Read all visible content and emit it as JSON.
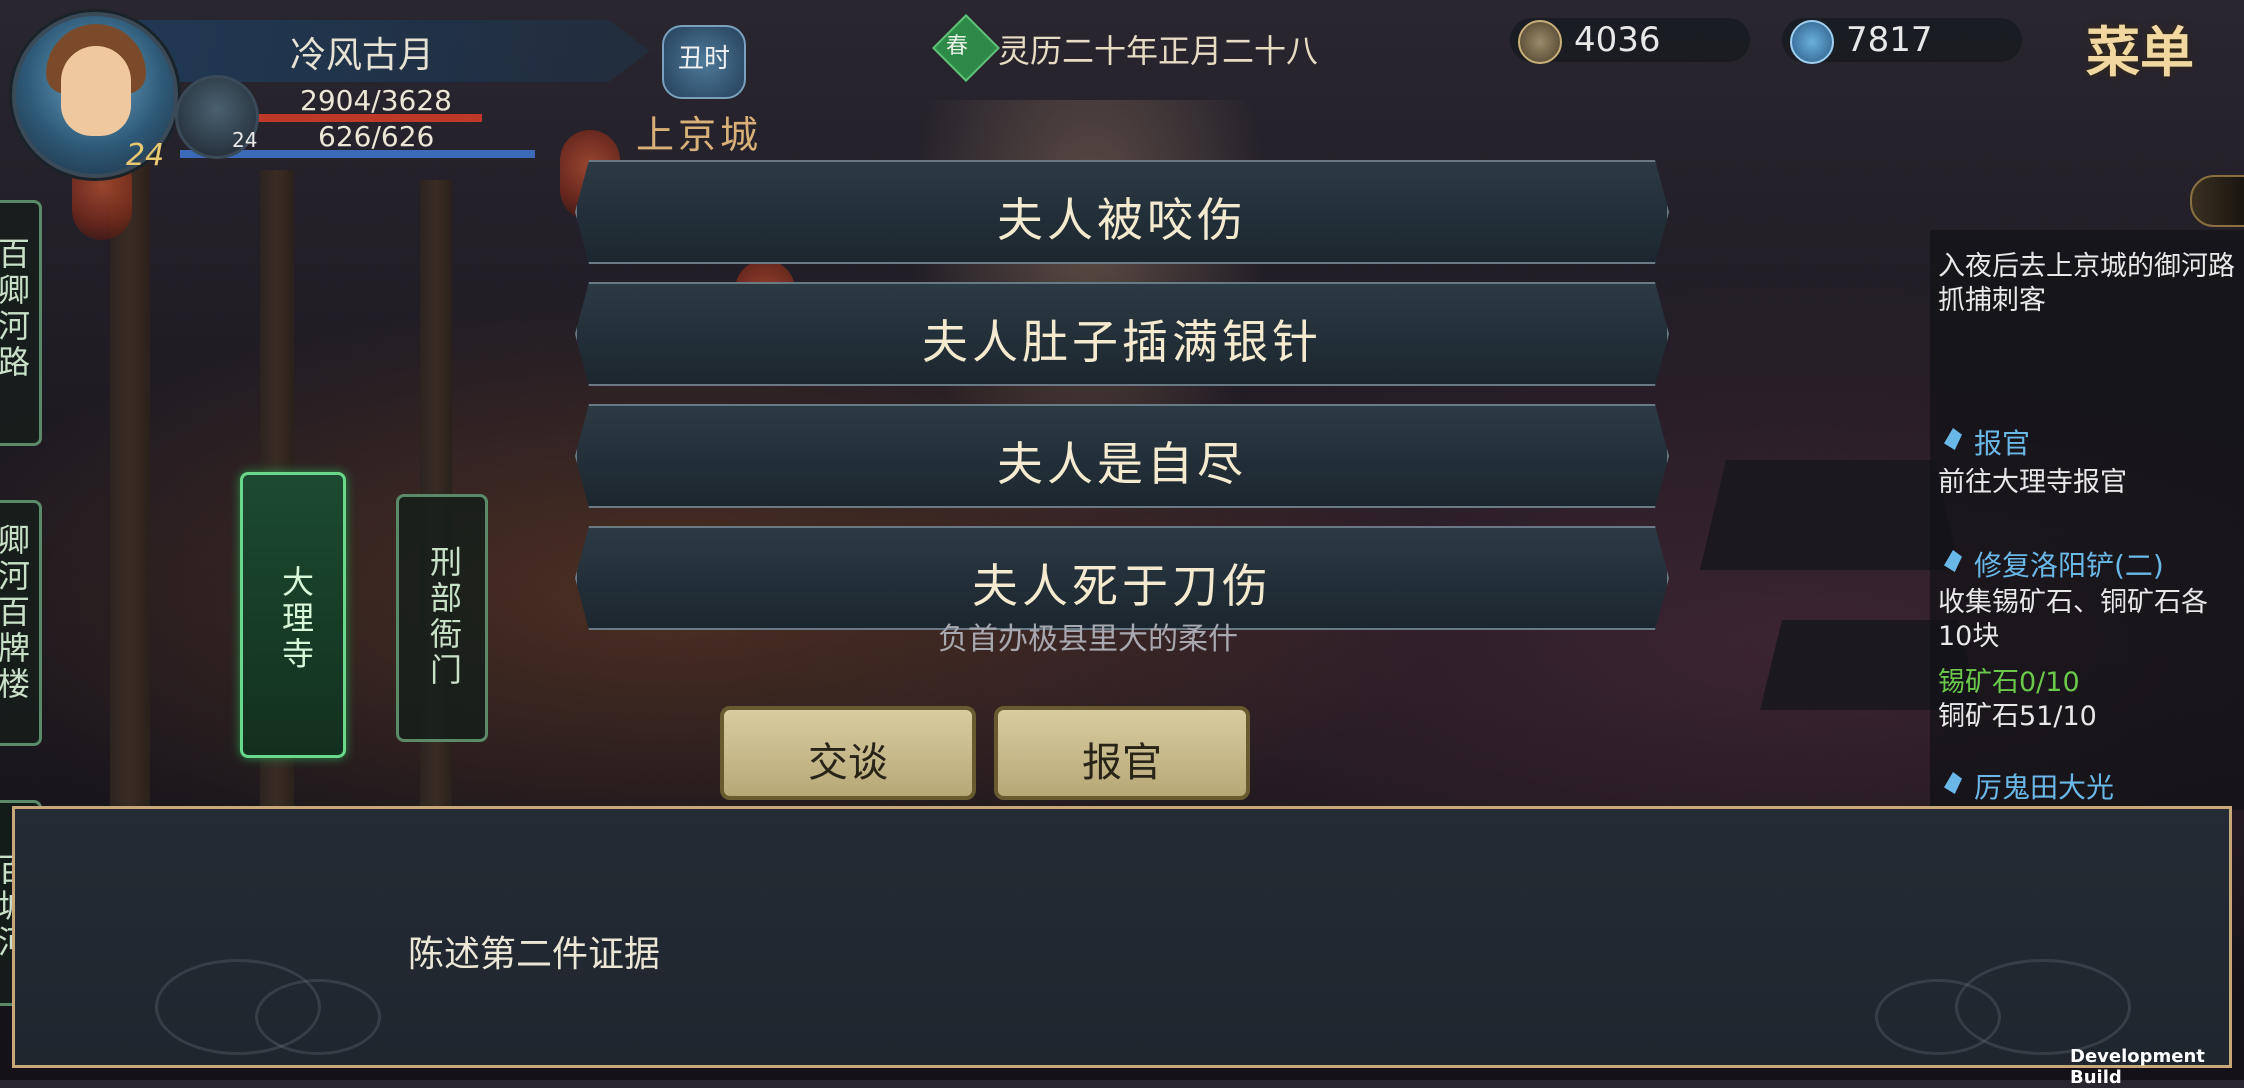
{
  "player": {
    "name": "冷风古月",
    "hp": "2904/3628",
    "mp": "626/626",
    "level": "24",
    "companion_level": "24"
  },
  "time": {
    "shichen": "丑时"
  },
  "location": {
    "city": "上京城"
  },
  "calendar": {
    "season": "春",
    "date": "灵历二十年正月二十八"
  },
  "currency": {
    "coins": "4036",
    "spirit": "7817"
  },
  "menu": {
    "label": "菜单"
  },
  "quests": {
    "intro": "入夜后去上京城的御河路抓捕刺客",
    "items": [
      {
        "title": "报官",
        "desc": "前往大理寺报官"
      },
      {
        "title": "修复洛阳铲(二)",
        "desc": "收集锡矿石、铜矿石各10块",
        "progress1": "锡矿石0/10",
        "progress2": "铜矿石51/10"
      },
      {
        "title": "厉鬼田大光"
      }
    ]
  },
  "signs": {
    "left1": "百卿河路",
    "left2": "卿河百牌楼",
    "left3": "百城河",
    "dali": "大理寺",
    "xingbu": "刑部衙门"
  },
  "choices": [
    "夫人被咬伤",
    "夫人肚子插满银针",
    "夫人是自尽",
    "夫人死于刀伤"
  ],
  "partial_text": "负首办极县里大的柔什",
  "actions": {
    "talk": "交谈",
    "report": "报官"
  },
  "dialog": {
    "text": "陈述第二件证据"
  },
  "footer": {
    "build": "Development Build"
  },
  "colors": {
    "accent_gold": "#c8a878",
    "quest_blue": "#6ab8e8",
    "progress_green": "#6ac84a",
    "hp_red": "#c03828",
    "mp_blue": "#3a6ab8"
  }
}
